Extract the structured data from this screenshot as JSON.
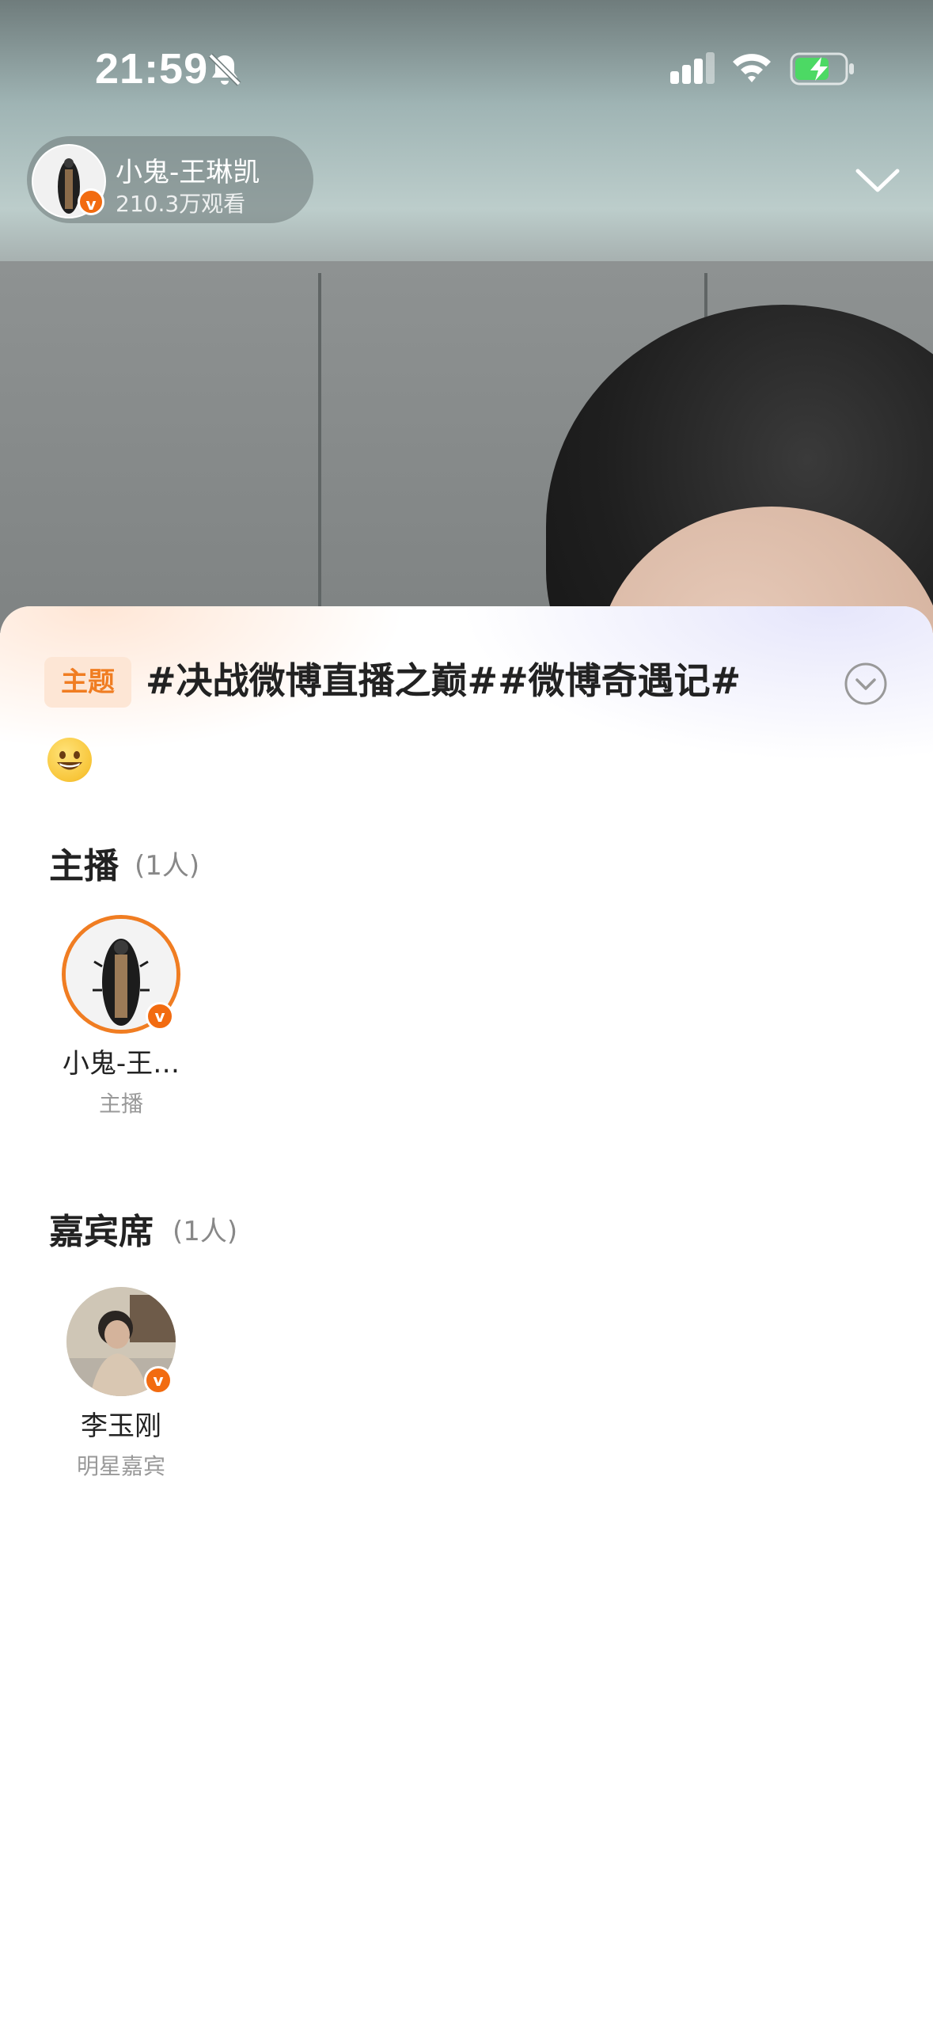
{
  "status_bar": {
    "time": "21:59"
  },
  "stream": {
    "host_name": "小鬼-王琳凯",
    "view_count": "210.3万观看"
  },
  "sheet": {
    "topic_tag": "主题",
    "topic_text": "#决战微博直播之巅##微博奇遇记#",
    "host_section": {
      "title": "主播",
      "count": "(1人)",
      "members": [
        {
          "name": "小鬼-王…",
          "role": "主播"
        }
      ]
    },
    "guest_section": {
      "title": "嘉宾席",
      "count": "(1人)",
      "members": [
        {
          "name": "李玉刚",
          "role": "明星嘉宾"
        }
      ]
    }
  },
  "colors": {
    "accent_orange": "#f07d22",
    "verified_badge": "#f26b10",
    "battery_green": "#4cd964"
  },
  "icons": {
    "mute": "bell-slash-icon",
    "signal": "cellular-signal-icon",
    "wifi": "wifi-icon",
    "battery": "battery-charging-icon",
    "collapse": "chevron-down-icon",
    "expand_topic": "circle-chevron-down-icon",
    "verified": "verified-v-icon",
    "emoji": "grinning-face-icon"
  }
}
